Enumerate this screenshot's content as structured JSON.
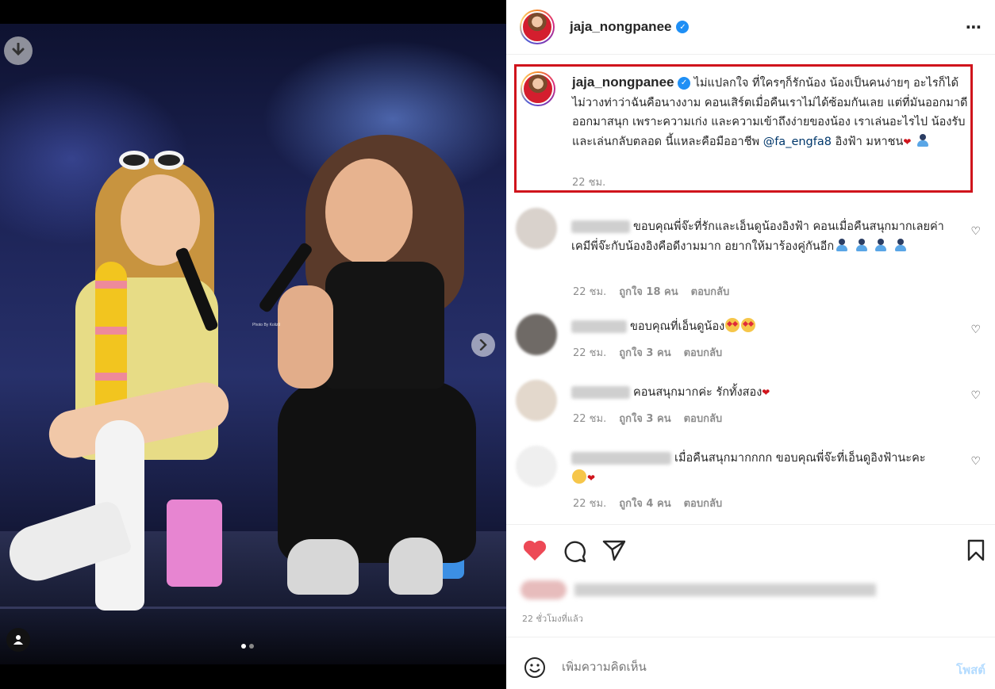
{
  "post": {
    "username": "jaja_nongpanee",
    "more_icon": "⋯",
    "caption": "ไม่แปลกใจ ที่ใครๆก็รักน้อง น้องเป็นคนง่ายๆ อะไรก็ได้ ไม่วางท่าว่าฉันคือนางงาม คอนเสิร์ตเมื่อคืนเราไม่ได้ซ้อมกันเลย แต่ที่มันออกมาดี ออกมาสนุก เพราะความเก่ง และความเข้าถึงง่ายของน้อง เราเล่นอะไรไป น้องรับและเล่นกลับตลอด นี้แหละคือมืออาชีพ",
    "mention": "@fa_engfa8",
    "caption_tail": "อิงฟ้า มหาชน",
    "caption_time": "22 ชม.",
    "photo_credit": "Photo By Koliz9",
    "likes_time": "22 ชั่วโมงที่แล้ว",
    "carousel": {
      "count": 2,
      "active": 1
    }
  },
  "comments": [
    {
      "text": "ขอบคุณพี่จ๊ะที่รักและเอ็นดูน้องอิงฟ้า คอนเมื่อคืนสนุกมากเลยค่า เคมีพี่จ๊ะกับน้องอิงคือดีงามมาก อยากให้มาร้องคู่กันอีก",
      "time": "22 ชม.",
      "likes": "ถูกใจ 18 คน",
      "reply": "ตอบกลับ"
    },
    {
      "text": "ขอบคุณที่เอ็นดูน้อง",
      "time": "22 ชม.",
      "likes": "ถูกใจ 3 คน",
      "reply": "ตอบกลับ"
    },
    {
      "text": "คอนสนุกมากค่ะ รักทั้งสอง",
      "time": "22 ชม.",
      "likes": "ถูกใจ 3 คน",
      "reply": "ตอบกลับ"
    },
    {
      "text": "เมื่อคืนสนุกมากกกก ขอบคุณพี่จ๊ะที่เอ็นดูอิงฟ้านะคะ",
      "time": "22 ชม.",
      "likes": "ถูกใจ 4 คน",
      "reply": "ตอบกลับ"
    }
  ],
  "composer": {
    "placeholder": "เพิ่มความคิดเห็น",
    "post_label": "โพสต์"
  },
  "colors": {
    "accent_link": "#00376b",
    "like_red": "#ed4956",
    "highlight_box": "#d0141c",
    "post_disabled": "#b3dbff"
  }
}
